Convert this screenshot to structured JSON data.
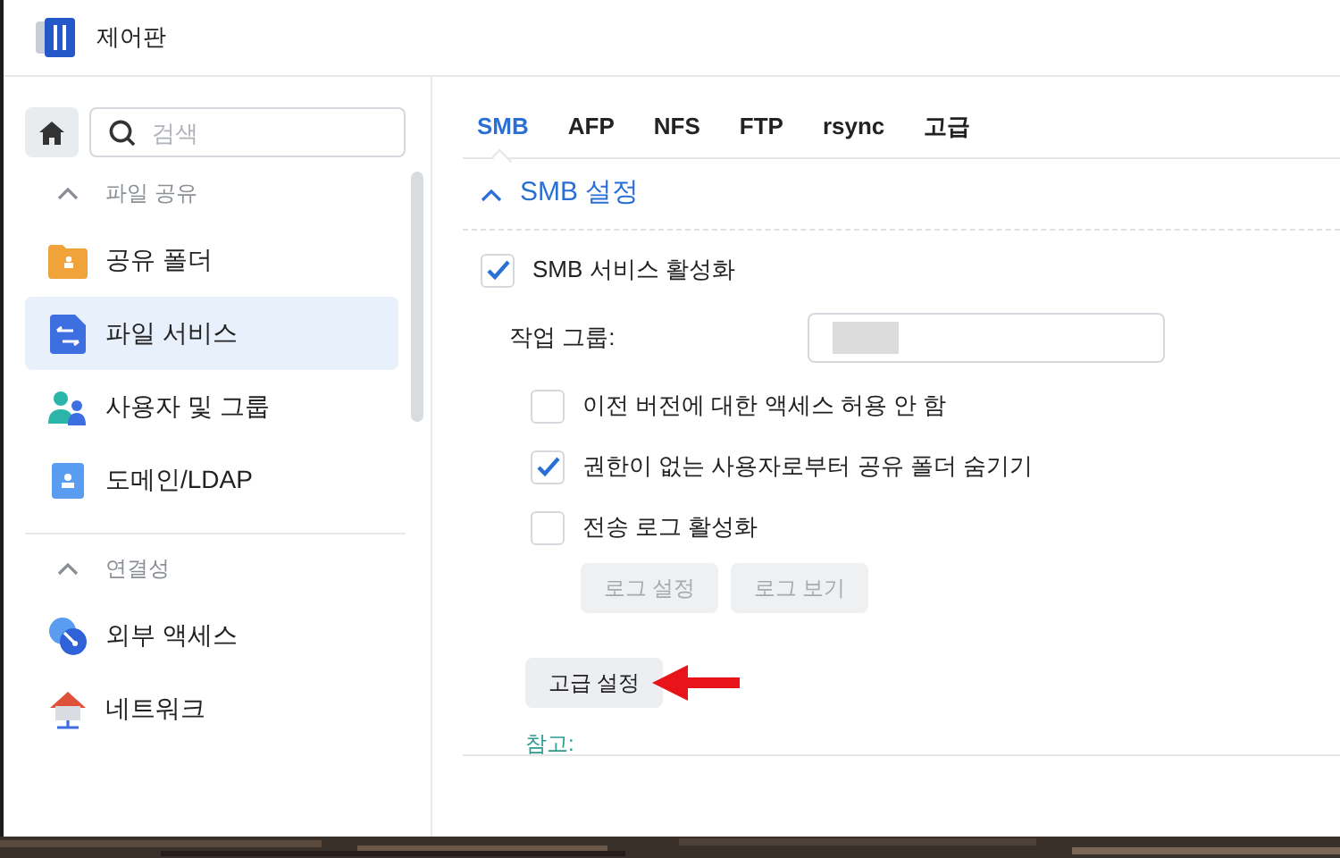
{
  "window": {
    "title": "제어판"
  },
  "sidebar": {
    "search": {
      "placeholder": "검색"
    },
    "groups": [
      {
        "label": "파일 공유",
        "expanded": true,
        "items": [
          {
            "label": "공유 폴더",
            "kind": "folder",
            "selected": false
          },
          {
            "label": "파일 서비스",
            "kind": "file-service",
            "selected": true
          },
          {
            "label": "사용자 및 그룹",
            "kind": "users",
            "selected": false
          },
          {
            "label": "도메인/LDAP",
            "kind": "domain",
            "selected": false
          }
        ]
      },
      {
        "label": "연결성",
        "expanded": true,
        "items": [
          {
            "label": "외부 액세스",
            "kind": "globe",
            "selected": false
          },
          {
            "label": "네트워크",
            "kind": "network",
            "selected": false
          }
        ]
      }
    ]
  },
  "tabs": [
    {
      "label": "SMB",
      "selected": true
    },
    {
      "label": "AFP",
      "selected": false
    },
    {
      "label": "NFS",
      "selected": false
    },
    {
      "label": "FTP",
      "selected": false
    },
    {
      "label": "rsync",
      "selected": false
    },
    {
      "label": "고급",
      "selected": false
    }
  ],
  "section": {
    "title": "SMB 설정",
    "expanded": true
  },
  "smb_service": {
    "label": "SMB 서비스 활성화",
    "checked": true
  },
  "workgroup": {
    "label": "작업 그룹:"
  },
  "options": [
    {
      "label": "이전 버전에 대한 액세스 허용 안 함",
      "checked": false
    },
    {
      "label": "권한이 없는 사용자로부터 공유 폴더 숨기기",
      "checked": true
    },
    {
      "label": "전송 로그 활성화",
      "checked": false
    }
  ],
  "log_buttons": [
    {
      "label": "로그 설정",
      "disabled": true
    },
    {
      "label": "로그 보기",
      "disabled": true
    }
  ],
  "advanced_button": {
    "label": "고급 설정"
  },
  "note": {
    "label": "참고:"
  }
}
